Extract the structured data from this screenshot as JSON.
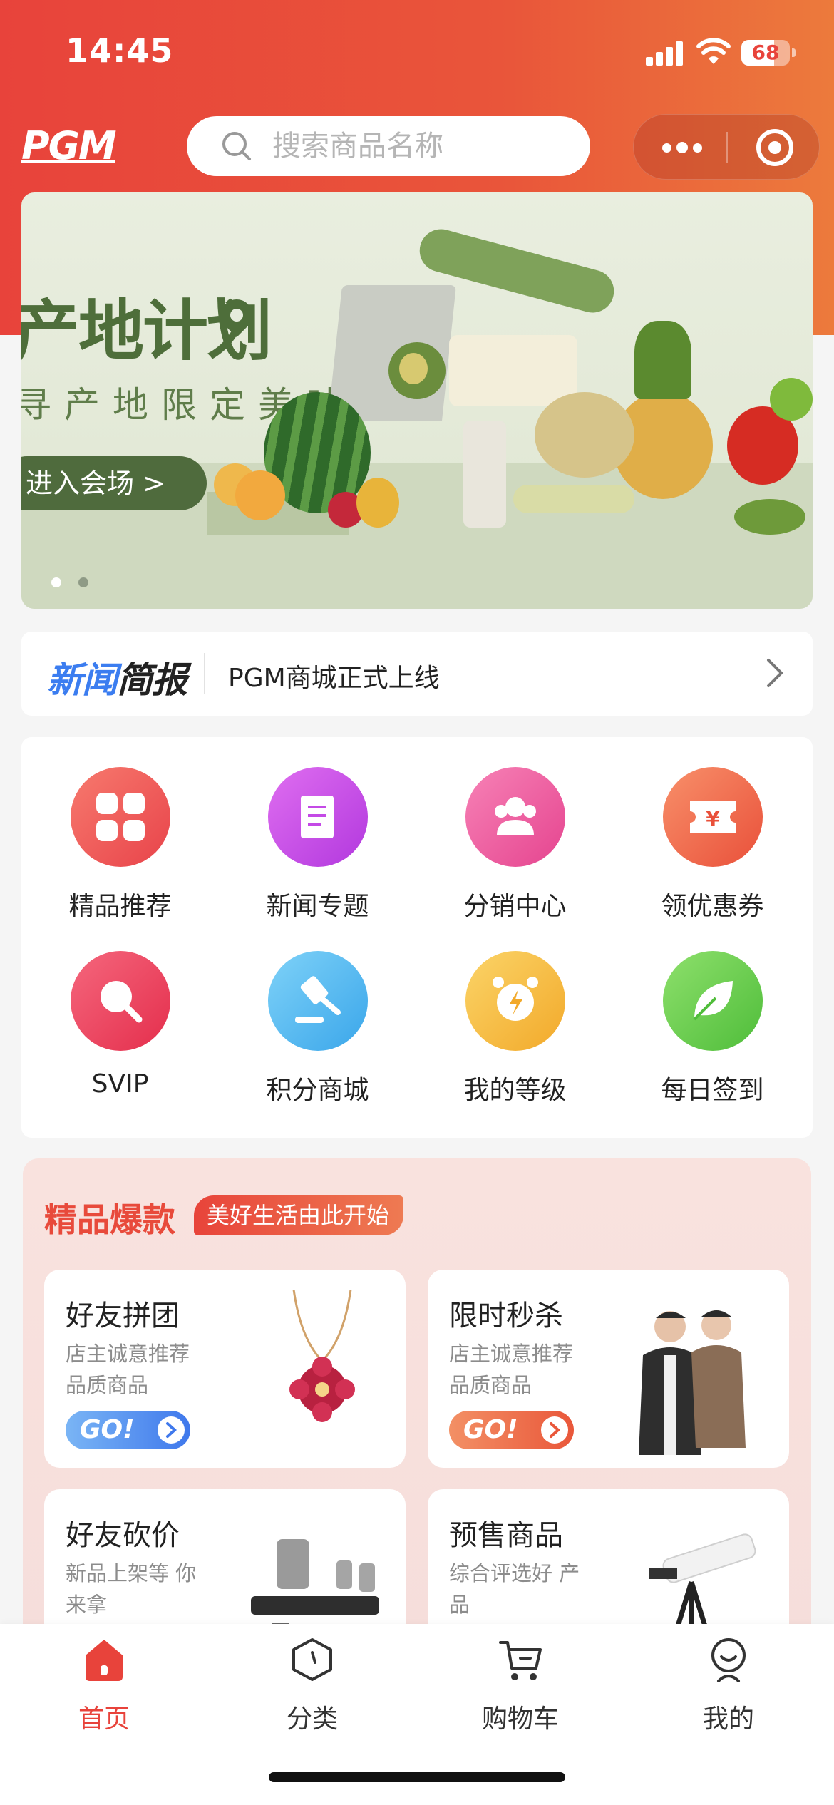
{
  "status_bar": {
    "time": "14:45",
    "battery": "68"
  },
  "header": {
    "logo_text": "PGM",
    "search_placeholder": "搜索商品名称",
    "capsule_more_icon": "more-dots-icon",
    "capsule_close_icon": "record-circle-icon"
  },
  "banner": {
    "title": "产地计划",
    "subtitle": "寻产地限定美味",
    "button": "进入会场 >",
    "slide_count": 2,
    "active_slide": 1
  },
  "news": {
    "tag_part1": "新闻",
    "tag_part2": "简报",
    "headline": "PGM商城正式上线"
  },
  "shortcuts": [
    {
      "label": "精品推荐",
      "icon": "grid-icon",
      "color": "#ef5350"
    },
    {
      "label": "新闻专题",
      "icon": "document-icon",
      "color": "#c44ae6"
    },
    {
      "label": "分销中心",
      "icon": "users-icon",
      "color": "#ee5c9e"
    },
    {
      "label": "领优惠券",
      "icon": "coupon-icon",
      "color": "#f06a45"
    },
    {
      "label": "SVIP",
      "icon": "magnifier-icon",
      "color": "#ed3f5c"
    },
    {
      "label": "积分商城",
      "icon": "gavel-icon",
      "color": "#4ab6ee"
    },
    {
      "label": "我的等级",
      "icon": "alarm-clock-icon",
      "color": "#f7bd3b"
    },
    {
      "label": "每日签到",
      "icon": "leaf-icon",
      "color": "#6ccb4e"
    }
  ],
  "featured": {
    "title": "精品爆款",
    "slogan": "美好生活由此开始",
    "cards": [
      {
        "title": "好友拼团",
        "subtitle": "店主诚意推荐品质商品",
        "go": "GO!",
        "go_color": "#4d8bf0",
        "image": "necklace-image"
      },
      {
        "title": "限时秒杀",
        "subtitle": "店主诚意推荐品质商品",
        "go": "GO!",
        "go_color": "#ee6a3d",
        "image": "jackets-image"
      },
      {
        "title": "好友砍价",
        "subtitle": "新品上架等 你来拿",
        "image": "speakers-image"
      },
      {
        "title": "预售商品",
        "subtitle": "综合评选好 产品",
        "image": "telescope-image"
      }
    ]
  },
  "tabbar": [
    {
      "label": "首页",
      "icon": "home-icon",
      "active": true
    },
    {
      "label": "分类",
      "icon": "category-icon",
      "active": false
    },
    {
      "label": "购物车",
      "icon": "cart-icon",
      "active": false
    },
    {
      "label": "我的",
      "icon": "profile-icon",
      "active": false
    }
  ],
  "colors": {
    "accent": "#e8433b",
    "tab_active": "#e8433b",
    "tab_inactive": "#333333"
  }
}
